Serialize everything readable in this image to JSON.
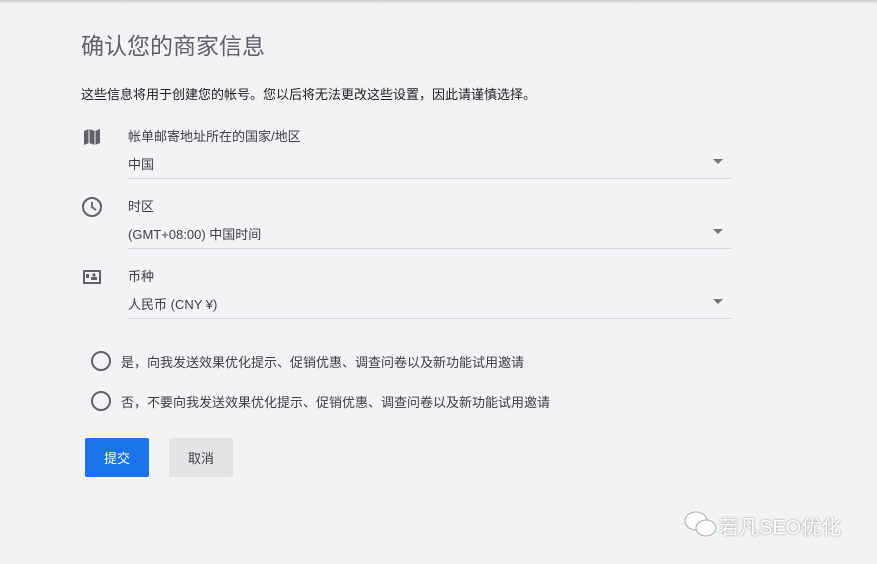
{
  "title": "确认您的商家信息",
  "description": "这些信息将用于创建您的帐号。您以后将无法更改这些设置，因此请谨慎选择。",
  "fields": [
    {
      "label": "帐单邮寄地址所在的国家/地区",
      "value": "中国",
      "icon": "map-icon"
    },
    {
      "label": "时区",
      "value": "(GMT+08:00) 中国时间",
      "icon": "clock-icon"
    },
    {
      "label": "币种",
      "value": "人民币 (CNY ¥)",
      "icon": "currency-icon"
    }
  ],
  "options": [
    "是，向我发送效果优化提示、促销优惠、调查问卷以及新功能试用邀请",
    "否，不要向我发送效果优化提示、促销优惠、调查问卷以及新功能试用邀请"
  ],
  "buttons": {
    "submit": "提交",
    "cancel": "取消"
  },
  "watermark": "若凡SEO优化"
}
